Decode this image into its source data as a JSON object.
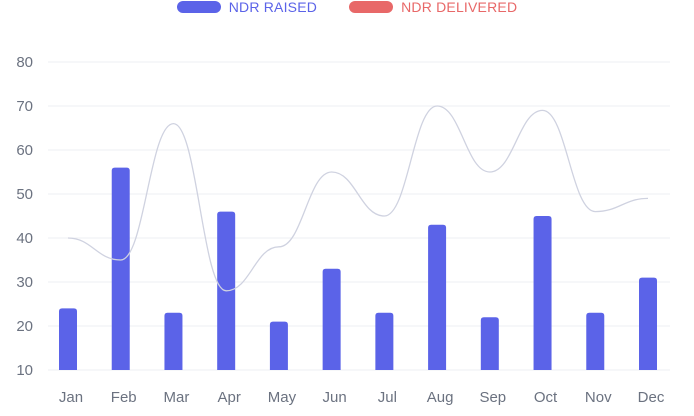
{
  "chart_data": {
    "type": "bar",
    "categories": [
      "Jan",
      "Feb",
      "Mar",
      "Apr",
      "May",
      "Jun",
      "Jul",
      "Aug",
      "Sep",
      "Oct",
      "Nov",
      "Dec"
    ],
    "series": [
      {
        "name": "NDR RAISED",
        "type": "bar",
        "color": "#5b63e8",
        "values": [
          24,
          56,
          23,
          46,
          21,
          33,
          23,
          43,
          22,
          45,
          23,
          31
        ]
      },
      {
        "name": "NDR DELIVERED",
        "type": "line",
        "color": "#e86868",
        "line_color": "#cfd2e0",
        "values": [
          40,
          35,
          66,
          28,
          38,
          55,
          45,
          70,
          55,
          69,
          46,
          49
        ]
      }
    ],
    "yticks": [
      10,
      20,
      30,
      40,
      50,
      60,
      70,
      80
    ],
    "ylim": [
      10,
      80
    ],
    "grid": true,
    "legend_position": "top-center"
  }
}
